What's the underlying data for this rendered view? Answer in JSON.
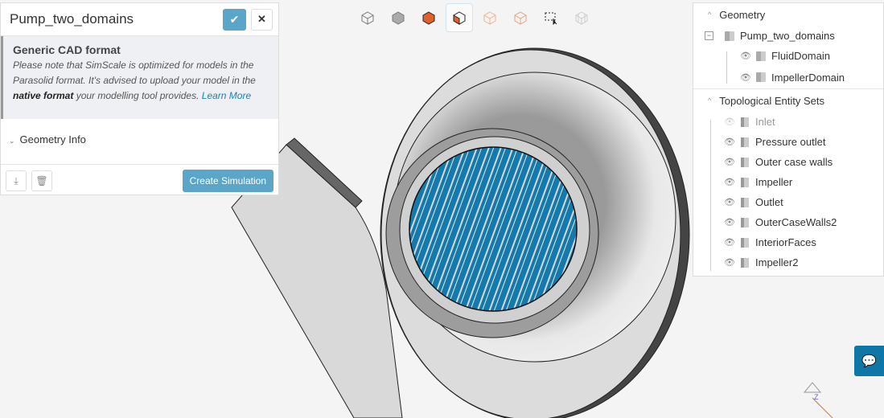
{
  "panel": {
    "title": "Pump_two_domains",
    "notice_title": "Generic CAD format",
    "notice_text_1": "Please note that SimScale is optimized for models in the Parasolid format. It's advised to upload your model in the ",
    "notice_bold": "native format",
    "notice_text_2": " your modelling tool provides. ",
    "learn_more": "Learn More",
    "geometry_info": "Geometry Info",
    "create_simulation": "Create Simulation"
  },
  "toolbar": {
    "icons": [
      "wireframe-cube-icon",
      "solid-cube-icon",
      "orange-solid-cube-icon",
      "orange-faces-cube-icon",
      "orange-edges-cube-icon",
      "orange-outline-cube-icon",
      "box-select-icon",
      "grid-cube-icon"
    ],
    "active_index": 3
  },
  "tree": {
    "geometry_label": "Geometry",
    "root": "Pump_two_domains",
    "bodies": [
      {
        "label": "FluidDomain"
      },
      {
        "label": "ImpellerDomain"
      }
    ],
    "sets_label": "Topological Entity Sets",
    "sets": [
      {
        "label": "Inlet",
        "hidden": true
      },
      {
        "label": "Pressure outlet"
      },
      {
        "label": "Outer case walls"
      },
      {
        "label": "Impeller"
      },
      {
        "label": "Outlet"
      },
      {
        "label": "OuterCaseWalls2"
      },
      {
        "label": "InteriorFaces"
      },
      {
        "label": "Impeller2"
      }
    ]
  },
  "colors": {
    "accent": "#5aa5c8",
    "impeller": "#1479ab",
    "link": "#1a7fb5"
  }
}
